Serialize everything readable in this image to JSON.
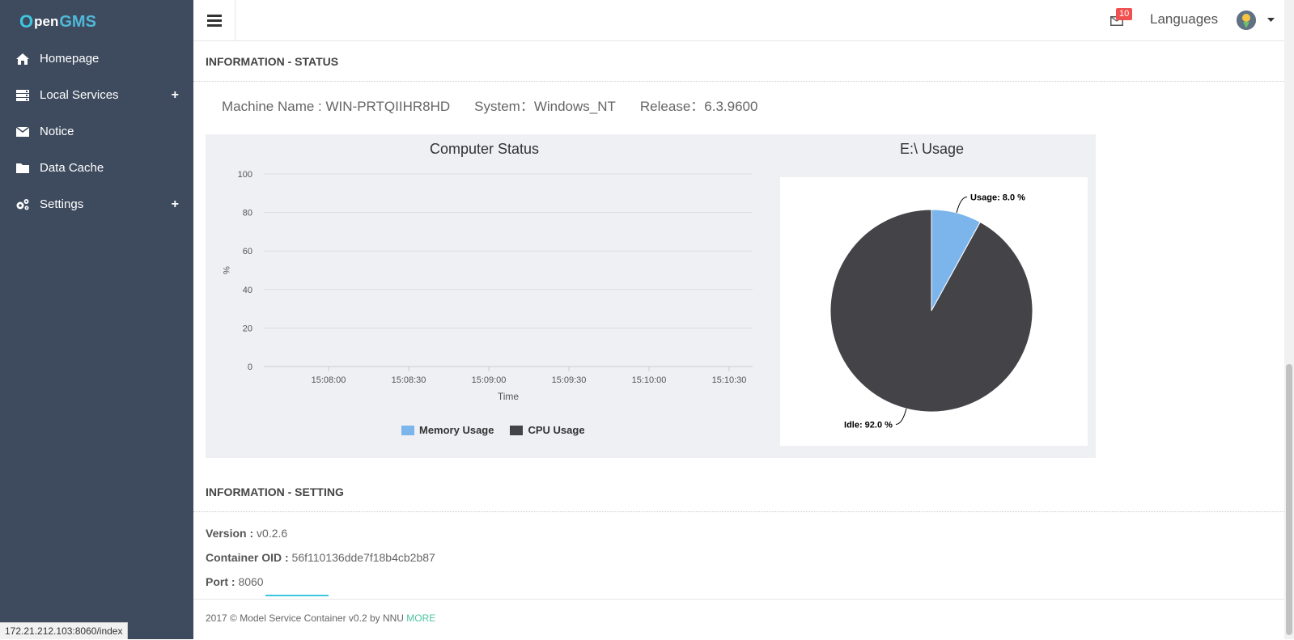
{
  "logo": {
    "mark": "O",
    "pen": "pen",
    "gms": "GMS"
  },
  "sidebar": {
    "items": [
      {
        "label": "Homepage",
        "icon": "home-icon"
      },
      {
        "label": "Local Services",
        "icon": "server-icon",
        "expand": "+"
      },
      {
        "label": "Notice",
        "icon": "envelope-icon"
      },
      {
        "label": "Data Cache",
        "icon": "folder-icon"
      },
      {
        "label": "Settings",
        "icon": "gears-icon",
        "expand": "+"
      }
    ]
  },
  "status_url": "172.21.212.103:8060/index",
  "topbar": {
    "mail_count": "10",
    "languages": "Languages"
  },
  "status_section": {
    "title": "INFORMATION - STATUS",
    "machine_name": "Machine Name : WIN-PRTQIIHR8HD",
    "system": "System：Windows_NT",
    "release": "Release：6.3.9600"
  },
  "chart_data": [
    {
      "type": "line",
      "title": "Computer Status",
      "xlabel": "Time",
      "ylabel": "%",
      "ylim": [
        0,
        100
      ],
      "y_ticks": [
        "100",
        "80",
        "60",
        "40",
        "20",
        "0"
      ],
      "x": [
        "15:08:00",
        "15:08:30",
        "15:09:00",
        "15:09:30",
        "15:10:00",
        "15:10:30"
      ],
      "series": [
        {
          "name": "Memory Usage",
          "color": "#7cb5ec",
          "values": []
        },
        {
          "name": "CPU Usage",
          "color": "#434348",
          "values": []
        }
      ],
      "grid": true,
      "legend": "bottom"
    },
    {
      "type": "pie",
      "title": "E:\\ Usage",
      "slices": [
        {
          "name": "Usage",
          "value": 8.0,
          "label": "Usage: 8.0 %",
          "color": "#7cb5ec"
        },
        {
          "name": "Idle",
          "value": 92.0,
          "label": "Idle: 92.0 %",
          "color": "#434348"
        }
      ]
    }
  ],
  "setting_section": {
    "title": "INFORMATION - SETTING",
    "version_label": "Version :",
    "version_value": " v0.2.6",
    "oid_label": "Container OID :",
    "oid_value": " 56f110136dde7f18b4cb2b87",
    "port_label": "Port :",
    "port_value": " 8060"
  },
  "footer": {
    "text": "2017 © Model Service Container v0.2 by NNU ",
    "more": "MORE"
  }
}
